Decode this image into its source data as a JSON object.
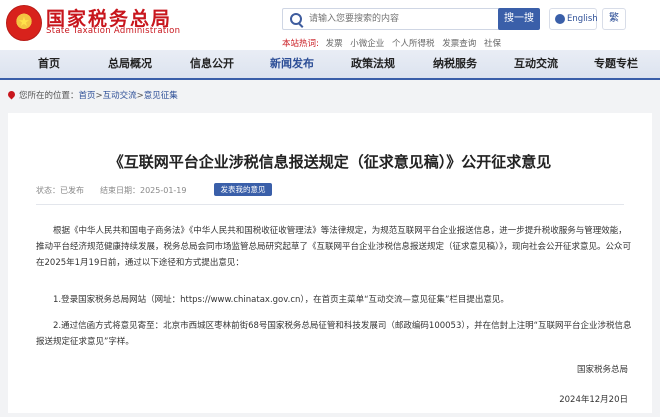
{
  "header": {
    "emblem_glyph": "★",
    "logo_cn": "国家税务总局",
    "logo_en": "State Taxation Administration",
    "search_placeholder": "请输入您要搜索的内容",
    "search_button": "搜一搜",
    "lang_label": "English",
    "trad_label": "繁",
    "hot_label": "本站热词:",
    "hot_words": [
      "发票",
      "小微企业",
      "个人所得税",
      "发票查询",
      "社保"
    ]
  },
  "nav": {
    "items": [
      "首页",
      "总局概况",
      "信息公开",
      "新闻发布",
      "政策法规",
      "纳税服务",
      "互动交流",
      "专题专栏"
    ],
    "active_index": 3
  },
  "breadcrumb": {
    "prefix": "您所在的位置：",
    "home": "首页",
    "sep1": ">",
    "section": "互动交流",
    "sep2": ">",
    "current": "意见征集"
  },
  "article": {
    "title": "《互联网平台企业涉税信息报送规定（征求意见稿）》公开征求意见",
    "status": "状态：已发布",
    "end_date": "结束日期：2025-01-19",
    "tag": "发表我的意见",
    "para1": "根据《中华人民共和国电子商务法》《中华人民共和国税收征收管理法》等法律规定，为规范互联网平台企业报送信息，进一步提升税收服务与管理效能，推动平台经济规范健康持续发展，税务总局会同市场监管总局研究起草了《互联网平台企业涉税信息报送规定（征求意见稿）》，现向社会公开征求意见。公众可在2025年1月19日前，通过以下途径和方式提出意见：",
    "para2": "1.登录国家税务总局网站（网址：https://www.chinatax.gov.cn），在首页主菜单“互动交流—意见征集”栏目提出意见。",
    "para3": "2.通过信函方式将意见寄至：北京市西城区枣林前街68号国家税务总局征管和科技发展司（邮政编码100053），并在信封上注明“互联网平台企业涉税信息报送规定征求意见”字样。",
    "signature": "国家税务总局",
    "date": "2024年12月20日"
  }
}
